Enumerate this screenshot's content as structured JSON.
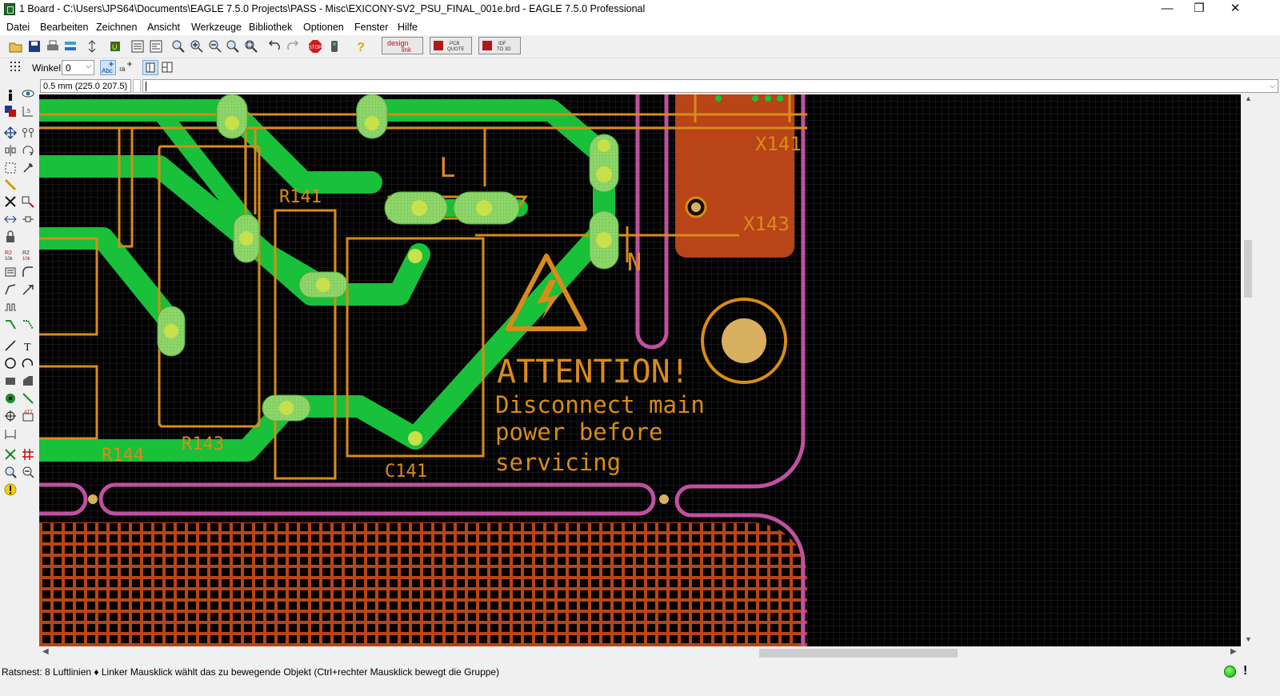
{
  "window": {
    "title": "1 Board - C:\\Users\\JPS64\\Documents\\EAGLE 7.5.0 Projects\\PASS - Misc\\EXICONY-SV2_PSU_FINAL_001e.brd - EAGLE 7.5.0 Professional",
    "minimize": "—",
    "maximize": "❐",
    "close": "✕"
  },
  "menu": [
    "Datei",
    "Bearbeiten",
    "Zeichnen",
    "Ansicht",
    "Werkzeuge",
    "Bibliothek",
    "Optionen",
    "Fenster",
    "Hilfe"
  ],
  "toolbar": {
    "designlink": [
      "design",
      "link"
    ],
    "pcb_quote": [
      "PCB",
      "QUOTE"
    ],
    "idf": [
      "IDF",
      "TO 3D"
    ],
    "stop": "STOP",
    "help": "?"
  },
  "parambar": {
    "winkel_label": "Winkel:",
    "winkel_value": "0",
    "abc": "Abc"
  },
  "commandline": {
    "coordinate": "0.5 mm (225.0 207.5)",
    "command": ""
  },
  "board": {
    "labels": [
      "L",
      "R141",
      "X141",
      "X143",
      "N",
      "R143",
      "R144",
      "C141"
    ],
    "warning": [
      "ATTENTION!",
      "Disconnect main",
      "power before",
      "servicing"
    ],
    "colors": {
      "background": "#000000",
      "grid": "#3a3a3a",
      "top_copper": "#19c03a",
      "pad": "#8fd66b",
      "silkscreen": "#d98b1a",
      "bottom_copper": "#b84418",
      "outline": "#c050a0"
    }
  },
  "status": {
    "text": "Ratsnest: 8 Luftlinien  ♦ Linker Mausklick wählt das zu bewegende Objekt (Ctrl+rechter Mausklick bewegt die Gruppe)",
    "exclaim": "!"
  }
}
